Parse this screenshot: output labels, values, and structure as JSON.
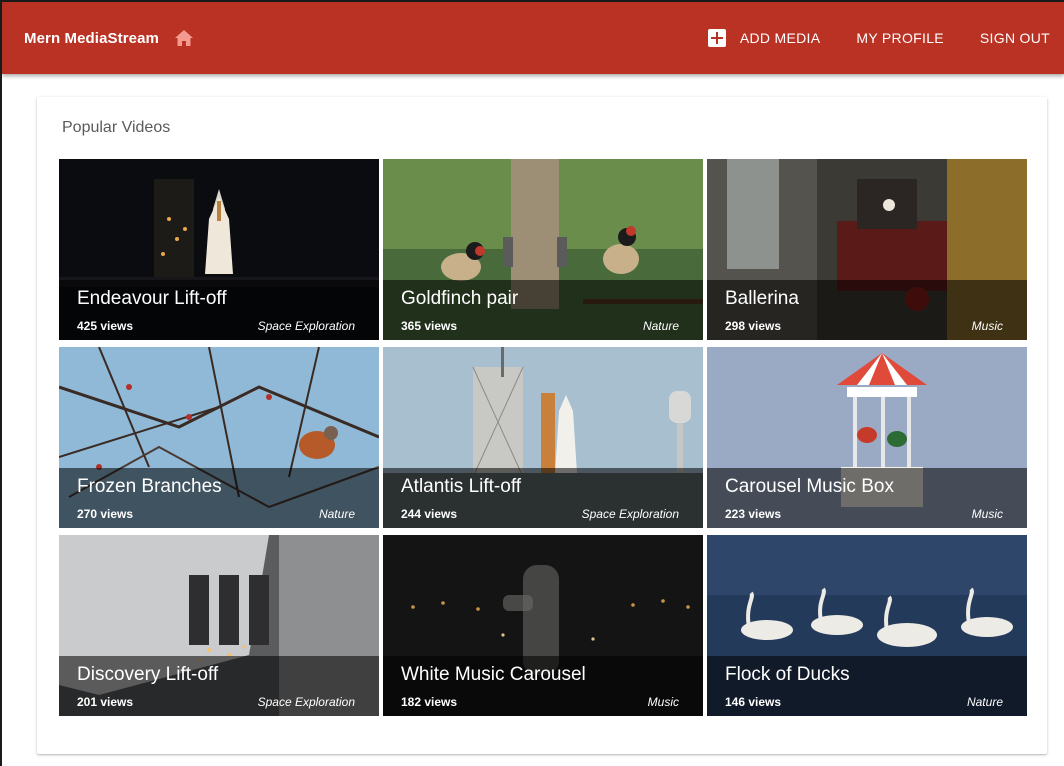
{
  "appbar": {
    "brand": "Mern MediaStream",
    "icon": "home-icon",
    "nav": {
      "add_media": "ADD MEDIA",
      "my_profile": "MY PROFILE",
      "sign_out": "SIGN OUT"
    },
    "color": "#b93224"
  },
  "card": {
    "title": "Popular Videos"
  },
  "videos": [
    {
      "title": "Endeavour Lift-off",
      "views": "425 views",
      "genre": "Space Exploration"
    },
    {
      "title": "Goldfinch pair",
      "views": "365 views",
      "genre": "Nature"
    },
    {
      "title": "Ballerina",
      "views": "298 views",
      "genre": "Music"
    },
    {
      "title": "Frozen Branches",
      "views": "270 views",
      "genre": "Nature"
    },
    {
      "title": "Atlantis Lift-off",
      "views": "244 views",
      "genre": "Space Exploration"
    },
    {
      "title": "Carousel Music Box",
      "views": "223 views",
      "genre": "Music"
    },
    {
      "title": "Discovery Lift-off",
      "views": "201 views",
      "genre": "Space Exploration"
    },
    {
      "title": "White Music Carousel",
      "views": "182 views",
      "genre": "Music"
    },
    {
      "title": "Flock of Ducks",
      "views": "146 views",
      "genre": "Nature"
    }
  ]
}
